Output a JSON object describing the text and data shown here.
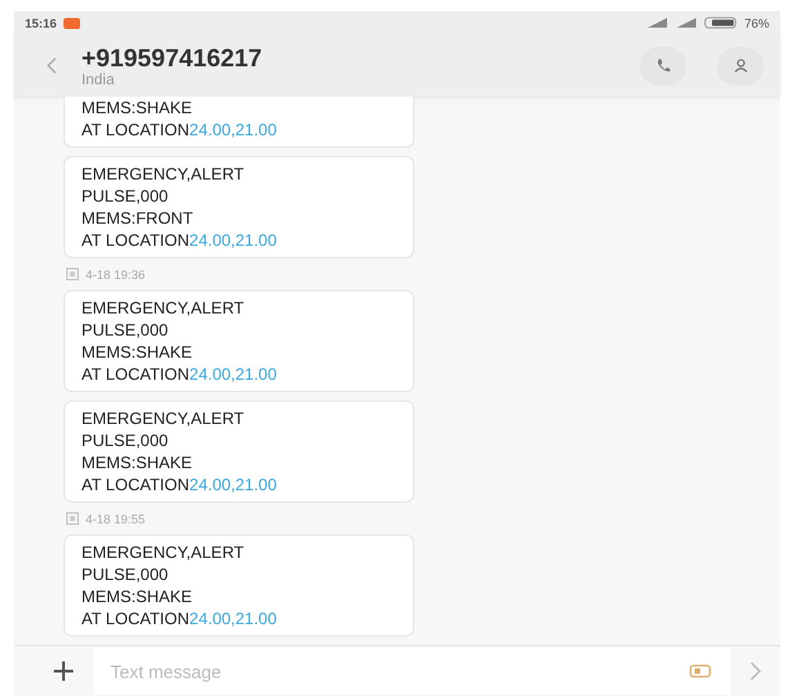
{
  "status_bar": {
    "time": "15:16",
    "battery": "76%"
  },
  "header": {
    "title": "+919597416217",
    "subtitle": "India"
  },
  "messages": [
    {
      "kind": "message",
      "lines": [
        "MEMS:SHAKE"
      ],
      "location_prefix": "AT LOCATION",
      "location_link": "24.00,21.00"
    },
    {
      "kind": "message",
      "lines": [
        "EMERGENCY,ALERT",
        "PULSE,000",
        "MEMS:FRONT"
      ],
      "location_prefix": "AT LOCATION",
      "location_link": "24.00,21.00"
    },
    {
      "kind": "timestamp",
      "text": "4-18 19:36"
    },
    {
      "kind": "message",
      "lines": [
        "EMERGENCY,ALERT",
        "PULSE,000",
        "MEMS:SHAKE"
      ],
      "location_prefix": "AT LOCATION",
      "location_link": "24.00,21.00"
    },
    {
      "kind": "message",
      "lines": [
        "EMERGENCY,ALERT",
        "PULSE,000",
        "MEMS:SHAKE"
      ],
      "location_prefix": "AT LOCATION",
      "location_link": "24.00,21.00"
    },
    {
      "kind": "timestamp",
      "text": "4-18 19:55"
    },
    {
      "kind": "message",
      "lines": [
        "EMERGENCY,ALERT",
        "PULSE,000",
        "MEMS:SHAKE"
      ],
      "location_prefix": "AT LOCATION",
      "location_link": "24.00,21.00"
    }
  ],
  "composer": {
    "placeholder": "Text message"
  }
}
